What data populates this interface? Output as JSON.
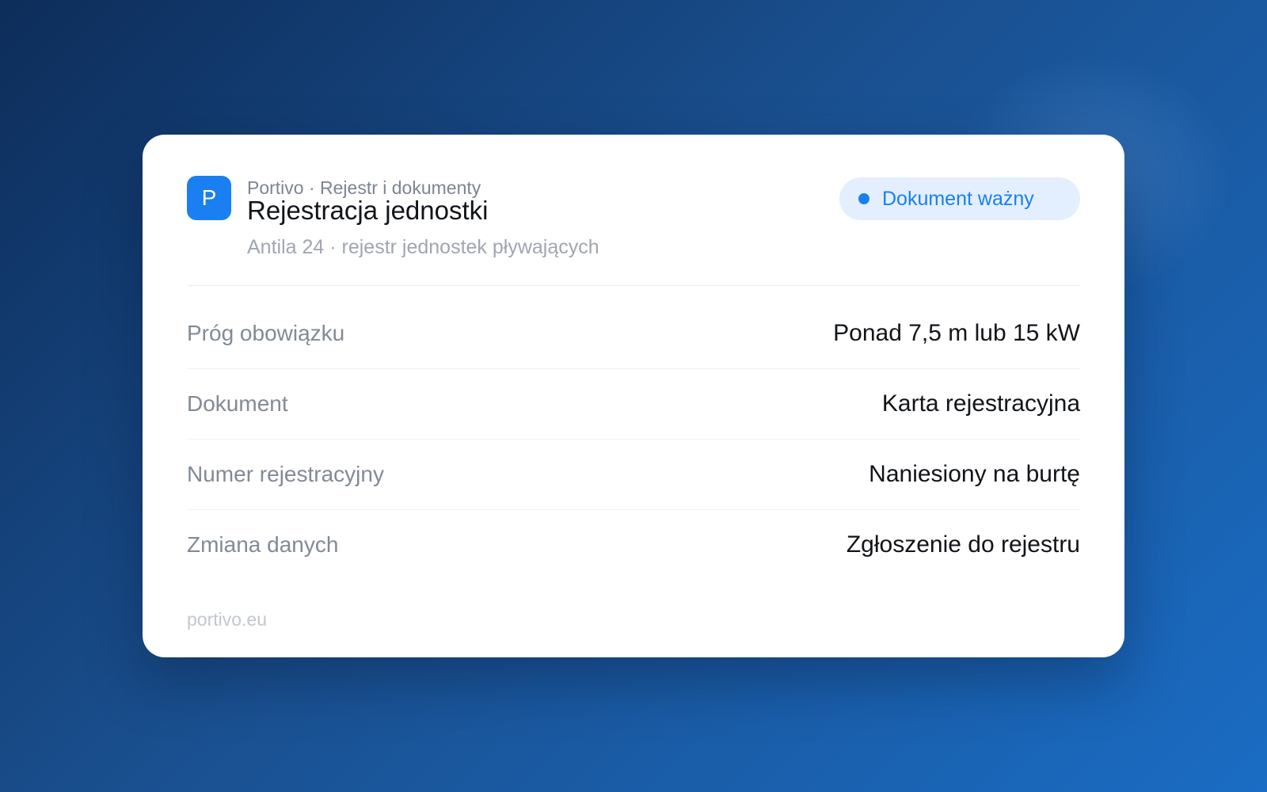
{
  "header": {
    "logo_letter": "P",
    "breadcrumb": "Portivo · Rejestr i dokumenty",
    "title": "Rejestracja jednostki",
    "subtitle": "Antila 24 · rejestr jednostek pływających",
    "status_badge": "Dokument ważny"
  },
  "rows": [
    {
      "label": "Próg obowiązku",
      "value": "Ponad 7,5 m lub 15 kW"
    },
    {
      "label": "Dokument",
      "value": "Karta rejestracyjna"
    },
    {
      "label": "Numer rejestracyjny",
      "value": "Naniesiony na burtę"
    },
    {
      "label": "Zmiana danych",
      "value": "Zgłoszenie do rejestru"
    }
  ],
  "footer": {
    "domain": "portivo.eu"
  },
  "colors": {
    "accent": "#1a7ff0",
    "badge_bg": "#e3efff"
  }
}
